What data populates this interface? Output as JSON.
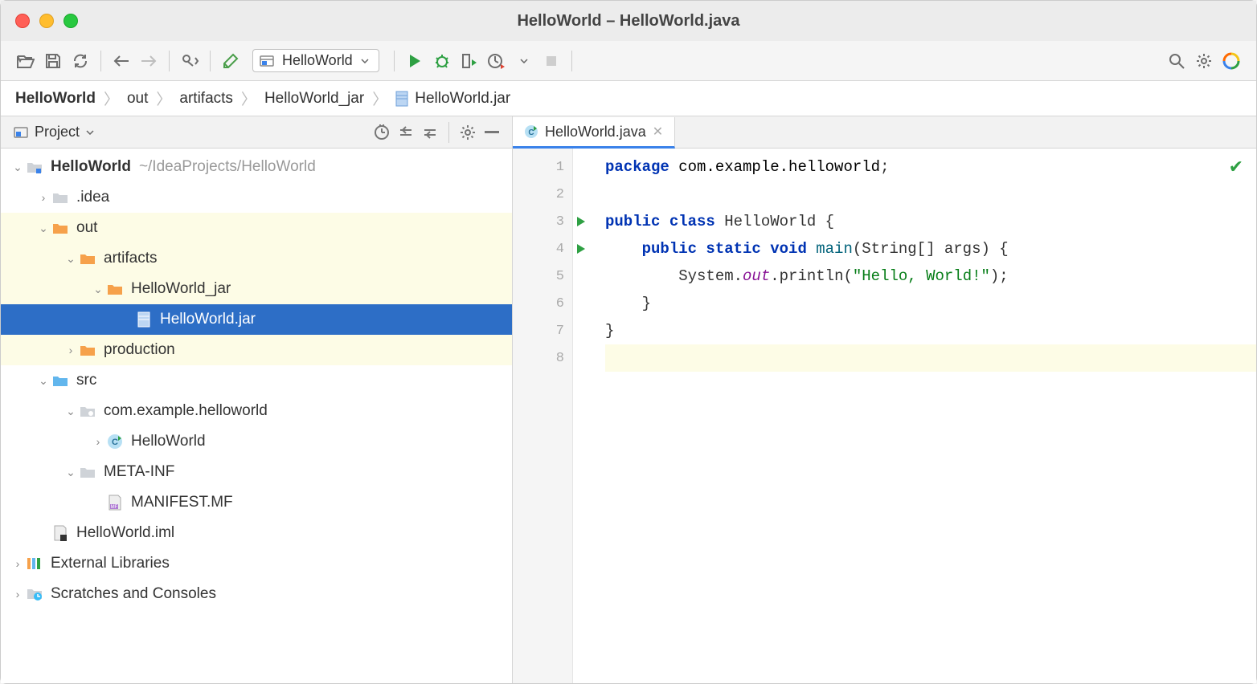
{
  "window": {
    "title": "HelloWorld – HelloWorld.java"
  },
  "toolbar": {
    "runConfig": "HelloWorld"
  },
  "breadcrumbs": {
    "root": "HelloWorld",
    "items": [
      "out",
      "artifacts",
      "HelloWorld_jar",
      "HelloWorld.jar"
    ]
  },
  "sidebar": {
    "title": "Project",
    "tree": {
      "root": "HelloWorld",
      "rootPath": "~/IdeaProjects/HelloWorld",
      "idea": ".idea",
      "out": "out",
      "artifacts": "artifacts",
      "hwjar_dir": "HelloWorld_jar",
      "jarfile": "HelloWorld.jar",
      "production": "production",
      "src": "src",
      "pkg": "com.example.helloworld",
      "cls": "HelloWorld",
      "metainf": "META-INF",
      "manifest": "MANIFEST.MF",
      "iml": "HelloWorld.iml",
      "extLibs": "External Libraries",
      "scratches": "Scratches and Consoles"
    }
  },
  "editor": {
    "tabLabel": "HelloWorld.java",
    "lines": [
      {
        "n": 1,
        "segs": [
          [
            "kw",
            "package "
          ],
          [
            "pkg",
            "com.example.helloworld"
          ],
          [
            "ident",
            ";"
          ]
        ]
      },
      {
        "n": 2,
        "segs": [
          [
            "ident",
            ""
          ]
        ]
      },
      {
        "n": 3,
        "run": true,
        "segs": [
          [
            "kw",
            "public class "
          ],
          [
            "ident",
            "HelloWorld {"
          ]
        ]
      },
      {
        "n": 4,
        "run": true,
        "segs": [
          [
            "ident",
            "    "
          ],
          [
            "kw",
            "public static void "
          ],
          [
            "fname",
            "main"
          ],
          [
            "ident",
            "(String[] args) {"
          ]
        ]
      },
      {
        "n": 5,
        "segs": [
          [
            "ident",
            "        System."
          ],
          [
            "field-it",
            "out"
          ],
          [
            "ident",
            ".println("
          ],
          [
            "str",
            "\"Hello, World!\""
          ],
          [
            "ident",
            ");"
          ]
        ]
      },
      {
        "n": 6,
        "segs": [
          [
            "ident",
            "    }"
          ]
        ]
      },
      {
        "n": 7,
        "segs": [
          [
            "ident",
            "}"
          ]
        ]
      },
      {
        "n": 8,
        "segs": [
          [
            "ident",
            ""
          ]
        ],
        "current": true
      }
    ]
  }
}
